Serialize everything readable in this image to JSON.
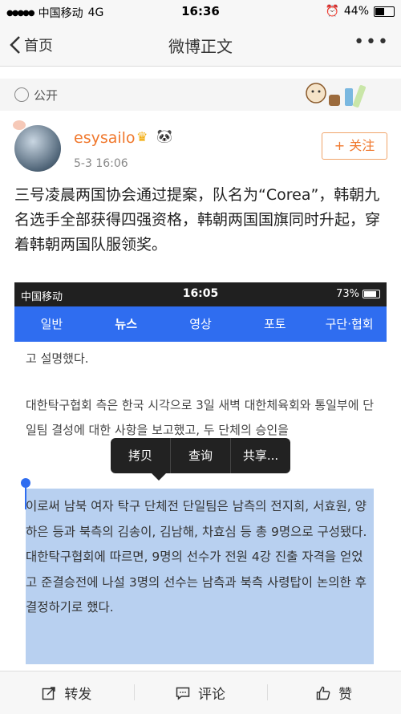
{
  "status_bar": {
    "carrier": "中国移动",
    "network": "4G",
    "time": "16:36",
    "battery": "44%"
  },
  "nav": {
    "back_label": "首页",
    "title": "微博正文",
    "more": "•••"
  },
  "visibility": {
    "label": "公开"
  },
  "post": {
    "username": "esysailo",
    "timestamp": "5-3 16:06",
    "follow_label": "+ 关注",
    "text": "三号凌晨两国协会通过提案，队名为“Corea”，韩朝九名选手全部获得四强资格，韩朝两国国旗同时升起，穿着韩朝两国队服领奖。"
  },
  "embedded": {
    "status": {
      "carrier": "中国移动",
      "time": "16:05",
      "battery": "73%"
    },
    "tabs": [
      "일반",
      "뉴스",
      "영상",
      "포토",
      "구단·협회"
    ],
    "para1": "고 설명했다.",
    "para2": "대한탁구협회 측은 한국 시각으로 3일 새벽 대한체육회와 통일부에 단일팀 결성에 대한 사항을 보고했고, 두 단체의 승인을",
    "selected_text": "이로써 남북 여자 탁구 단체전 단일팀은 남측의 전지희, 서효원, 양하은 등과 북측의 김송이, 김남해, 차효심 등 총 9명으로 구성됐다. 대한탁구협회에 따르면, 9명의 선수가 전원 4강 진출 자격을 얻었고 준결승전에 나설 3명의 선수는 남측과 북측 사령탑이 논의한 후 결정하기로 했다.",
    "context_menu": [
      "拷贝",
      "查询",
      "共享..."
    ]
  },
  "bottom_bar": {
    "repost": "转发",
    "comment": "评论",
    "like": "赞"
  }
}
